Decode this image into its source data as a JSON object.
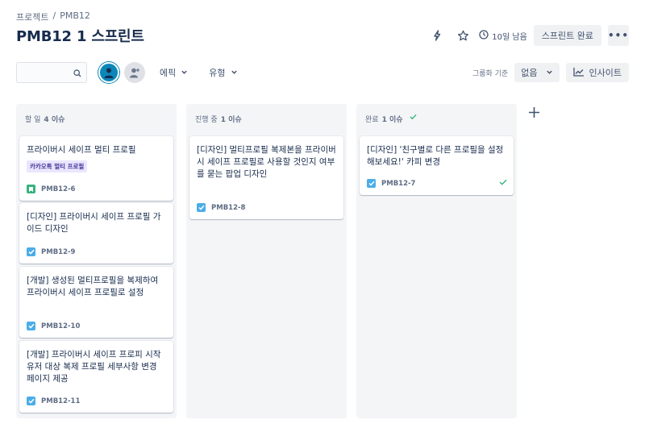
{
  "breadcrumb": {
    "project": "프로젝트",
    "separator": "/",
    "current": "PMB12"
  },
  "page_title": "PMB12 1 스프린트",
  "actions": {
    "time_remaining": "10일 남음",
    "complete_sprint": "스프린트 완료",
    "more": "•••"
  },
  "filters": {
    "search_placeholder": "",
    "epic": "에픽",
    "type": "유형",
    "group_by_label": "그룹화 기준",
    "group_by_value": "없음",
    "insights": "인사이트"
  },
  "columns": [
    {
      "name": "할 일",
      "count": "4 이슈",
      "cards": [
        {
          "title": "프라이버시 세이프 멀티 프로필",
          "epic": "카카오톡 멀티 프로필",
          "key": "PMB12-6",
          "type": "story"
        },
        {
          "title": "[디자인] 프라이버시 세이프 프로필 가이드 디자인",
          "key": "PMB12-9",
          "type": "task"
        },
        {
          "title": "[개발] 생성된 멀티프로필을 복제하여 프라이버시 세이프 프로필로 설정",
          "key": "PMB12-10",
          "type": "task"
        },
        {
          "title": "[개발] 프라이버시 세이프 프로피 시작 유저 대상 복제 프로필 세부사항 변경 페이지 제공",
          "key": "PMB12-11",
          "type": "task"
        }
      ]
    },
    {
      "name": "진행 중",
      "count": "1 이슈",
      "cards": [
        {
          "title": "[디자인] 멀티프로필 복제본을 프라이버시 세이프 프로필로 사용할 것인지 여부를 묻는 팝업 디자인",
          "key": "PMB12-8",
          "type": "task"
        }
      ]
    },
    {
      "name": "완료",
      "count": "1 이슈",
      "cards": [
        {
          "title": "[디자인] '친구별로 다른 프로필을 설정해보세요!' 카피 변경",
          "key": "PMB12-7",
          "type": "task"
        }
      ]
    }
  ],
  "colors": {
    "task_icon": "#4bade8",
    "story_icon": "#36b37e",
    "epic_bg": "#eae6ff",
    "epic_text": "#403294",
    "done_check": "#36b37e",
    "avatar_primary": "#0b86b9"
  },
  "icons": {
    "lightning": "lightning-icon",
    "star": "star-icon",
    "clock": "clock-icon",
    "search": "search-icon",
    "chevron": "chevron-down-icon",
    "insight": "line-chart-icon",
    "add": "plus-icon"
  }
}
